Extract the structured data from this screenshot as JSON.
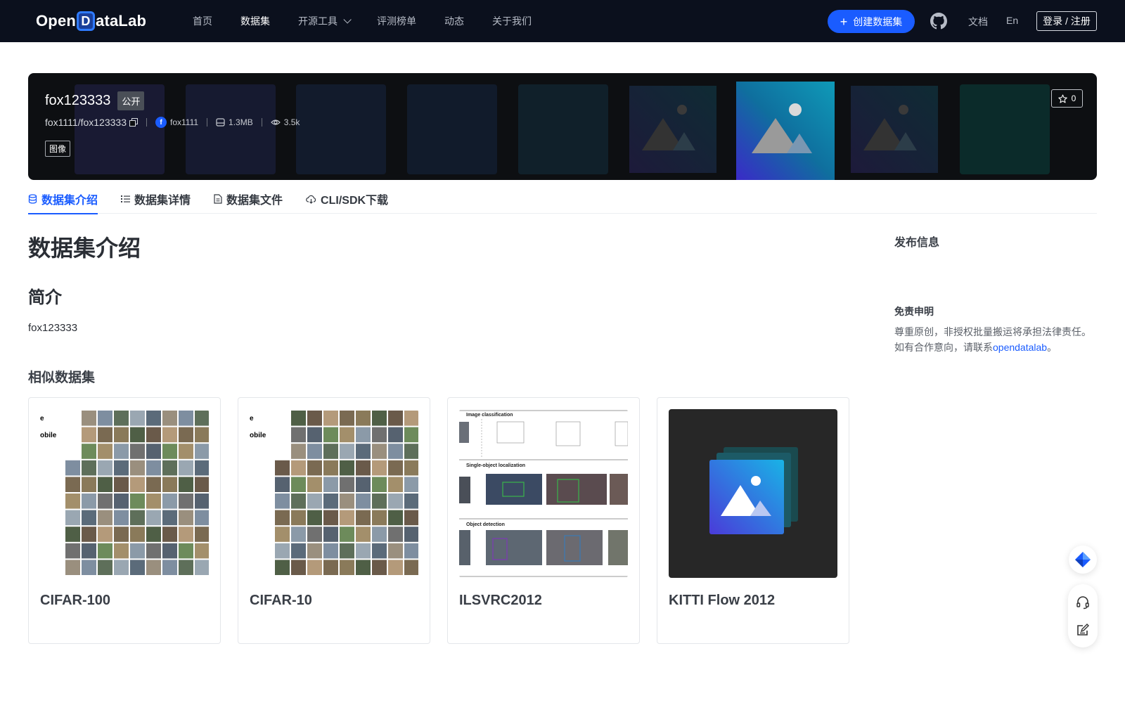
{
  "header": {
    "logo_left": "Open",
    "logo_d": "D",
    "logo_right": "ataLab",
    "nav": [
      {
        "label": "首页",
        "active": false
      },
      {
        "label": "数据集",
        "active": true
      },
      {
        "label": "开源工具",
        "active": false,
        "dropdown": true
      },
      {
        "label": "评测榜单",
        "active": false
      },
      {
        "label": "动态",
        "active": false
      },
      {
        "label": "关于我们",
        "active": false
      }
    ],
    "create_label": "创建数据集",
    "docs_label": "文档",
    "lang_label": "En",
    "login_label": "登录 / 注册",
    "accent_color": "#1a5cff"
  },
  "dataset": {
    "name": "fox123333",
    "visibility": "公开",
    "path": "fox1111/fox123333",
    "author_initial": "f",
    "author": "fox1111",
    "size": "1.3MB",
    "views": "3.5k",
    "tag": "图像",
    "stars": "0"
  },
  "tabs": [
    {
      "label": "数据集介绍",
      "icon": "database-icon",
      "active": true
    },
    {
      "label": "数据集详情",
      "icon": "list-icon",
      "active": false
    },
    {
      "label": "数据集文件",
      "icon": "file-icon",
      "active": false
    },
    {
      "label": "CLI/SDK下载",
      "icon": "cloud-download-icon",
      "active": false
    }
  ],
  "content": {
    "heading": "数据集介绍",
    "subheading": "简介",
    "intro_text": "fox123333",
    "similar_heading": "相似数据集",
    "similar": [
      {
        "title": "CIFAR-100"
      },
      {
        "title": "CIFAR-10"
      },
      {
        "title": "ILSVRC2012"
      },
      {
        "title": "KITTI Flow 2012"
      }
    ]
  },
  "sidebar": {
    "publish_title": "发布信息",
    "disclaimer_title": "免责申明",
    "disclaimer_line1": "尊重原创，非授权批量搬运将承担法律责任。",
    "disclaimer_line2_prefix": "如有合作意向，请联系",
    "disclaimer_link": "opendatalab",
    "disclaimer_line2_suffix": "。"
  }
}
